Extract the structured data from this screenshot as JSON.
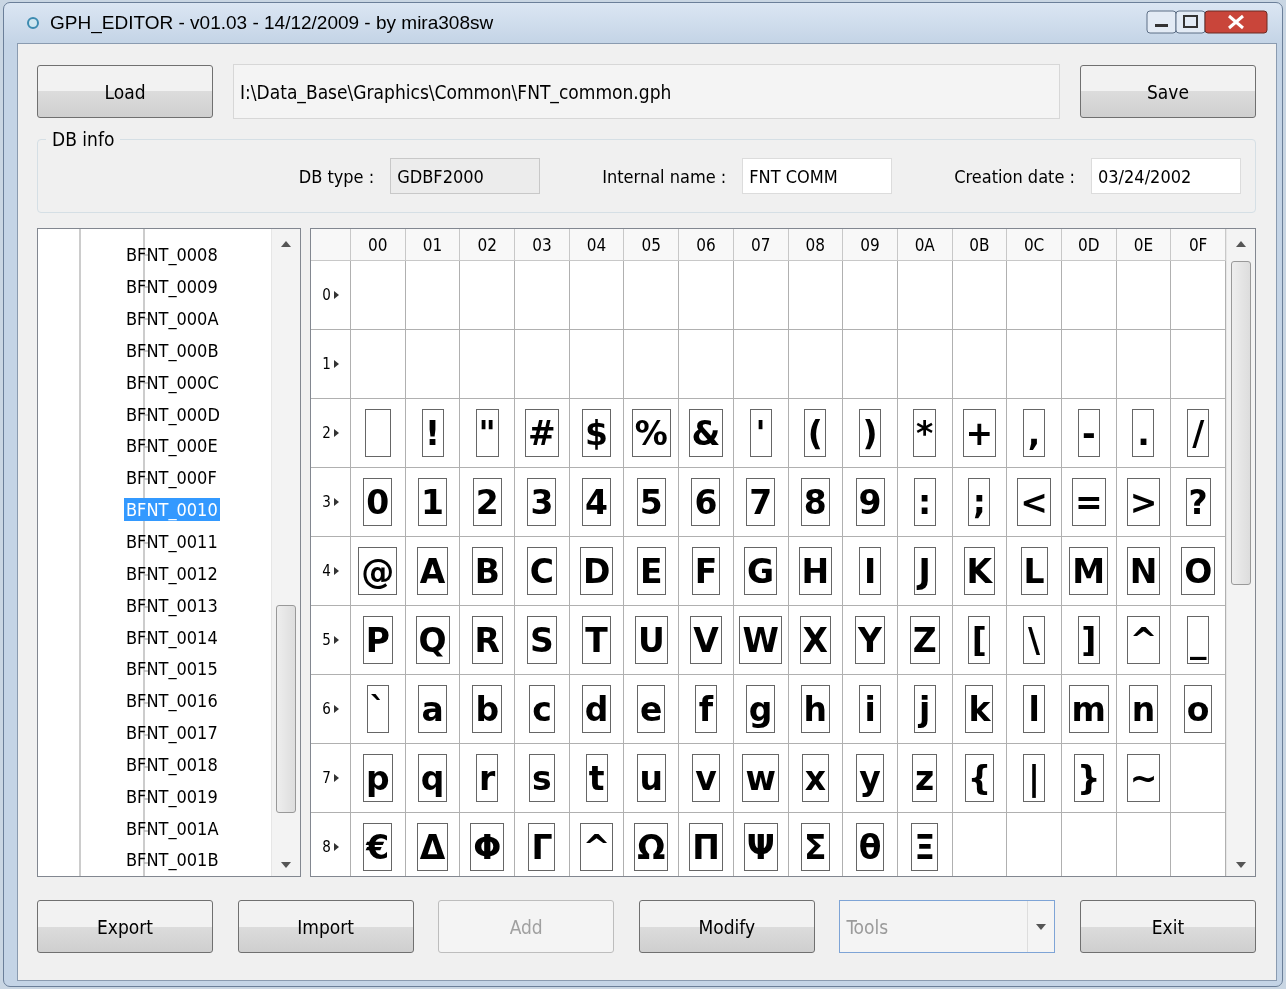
{
  "window": {
    "title": "GPH_EDITOR - v01.03 - 14/12/2009 - by mira308sw"
  },
  "top": {
    "load": "Load",
    "path": "I:\\Data_Base\\Graphics\\Common\\FNT_common.gph",
    "save": "Save"
  },
  "db_info": {
    "title": "DB info",
    "fields": [
      {
        "label": "DB type :",
        "value": "GDBF2000",
        "disabled": true
      },
      {
        "label": "Internal name :",
        "value": "FNT COMM",
        "disabled": false
      },
      {
        "label": "Creation date :",
        "value": "03/24/2002",
        "disabled": false
      }
    ]
  },
  "tree": {
    "items": [
      {
        "label": "BFNT_0008",
        "selected": false
      },
      {
        "label": "BFNT_0009",
        "selected": false
      },
      {
        "label": "BFNT_000A",
        "selected": false
      },
      {
        "label": "BFNT_000B",
        "selected": false
      },
      {
        "label": "BFNT_000C",
        "selected": false
      },
      {
        "label": "BFNT_000D",
        "selected": false
      },
      {
        "label": "BFNT_000E",
        "selected": false
      },
      {
        "label": "BFNT_000F",
        "selected": false
      },
      {
        "label": "BFNT_0010",
        "selected": true
      },
      {
        "label": "BFNT_0011",
        "selected": false
      },
      {
        "label": "BFNT_0012",
        "selected": false
      },
      {
        "label": "BFNT_0013",
        "selected": false
      },
      {
        "label": "BFNT_0014",
        "selected": false
      },
      {
        "label": "BFNT_0015",
        "selected": false
      },
      {
        "label": "BFNT_0016",
        "selected": false
      },
      {
        "label": "BFNT_0017",
        "selected": false
      },
      {
        "label": "BFNT_0018",
        "selected": false
      },
      {
        "label": "BFNT_0019",
        "selected": false
      },
      {
        "label": "BFNT_001A",
        "selected": false
      },
      {
        "label": "BFNT_001B",
        "selected": false
      }
    ]
  },
  "grid": {
    "columns": [
      "00",
      "01",
      "02",
      "03",
      "04",
      "05",
      "06",
      "07",
      "08",
      "09",
      "0A",
      "0B",
      "0C",
      "0D",
      "0E",
      "0F"
    ],
    "rows": [
      {
        "label": "0"
      },
      {
        "label": "1"
      },
      {
        "label": "2",
        "cells": [
          {
            "kind": "blank"
          },
          {
            "kind": "glyph",
            "char": "!"
          },
          {
            "kind": "glyph",
            "char": "\""
          },
          {
            "kind": "glyph",
            "char": "#"
          },
          {
            "kind": "glyph",
            "char": "$"
          },
          {
            "kind": "glyph",
            "char": "%"
          },
          {
            "kind": "glyph",
            "char": "&"
          },
          {
            "kind": "glyph",
            "char": "'"
          },
          {
            "kind": "glyph",
            "char": "("
          },
          {
            "kind": "glyph",
            "char": ")"
          },
          {
            "kind": "glyph",
            "char": "*"
          },
          {
            "kind": "glyph",
            "char": "+"
          },
          {
            "kind": "glyph",
            "char": ","
          },
          {
            "kind": "glyph",
            "char": "-"
          },
          {
            "kind": "glyph",
            "char": "."
          },
          {
            "kind": "glyph",
            "char": "/"
          }
        ]
      },
      {
        "label": "3",
        "cells": [
          {
            "kind": "glyph",
            "char": "0"
          },
          {
            "kind": "glyph",
            "char": "1"
          },
          {
            "kind": "glyph",
            "char": "2"
          },
          {
            "kind": "glyph",
            "char": "3"
          },
          {
            "kind": "glyph",
            "char": "4"
          },
          {
            "kind": "glyph",
            "char": "5"
          },
          {
            "kind": "glyph",
            "char": "6"
          },
          {
            "kind": "glyph",
            "char": "7"
          },
          {
            "kind": "glyph",
            "char": "8"
          },
          {
            "kind": "glyph",
            "char": "9"
          },
          {
            "kind": "glyph",
            "char": ":"
          },
          {
            "kind": "glyph",
            "char": ";"
          },
          {
            "kind": "glyph",
            "char": "<"
          },
          {
            "kind": "glyph",
            "char": "="
          },
          {
            "kind": "glyph",
            "char": ">"
          },
          {
            "kind": "glyph",
            "char": "?"
          }
        ]
      },
      {
        "label": "4",
        "cells": [
          {
            "kind": "glyph",
            "char": "@"
          },
          {
            "kind": "glyph",
            "char": "A"
          },
          {
            "kind": "glyph",
            "char": "B"
          },
          {
            "kind": "glyph",
            "char": "C"
          },
          {
            "kind": "glyph",
            "char": "D"
          },
          {
            "kind": "glyph",
            "char": "E"
          },
          {
            "kind": "glyph",
            "char": "F"
          },
          {
            "kind": "glyph",
            "char": "G"
          },
          {
            "kind": "glyph",
            "char": "H"
          },
          {
            "kind": "glyph",
            "char": "I"
          },
          {
            "kind": "glyph",
            "char": "J"
          },
          {
            "kind": "glyph",
            "char": "K"
          },
          {
            "kind": "glyph",
            "char": "L"
          },
          {
            "kind": "glyph",
            "char": "M"
          },
          {
            "kind": "glyph",
            "char": "N"
          },
          {
            "kind": "glyph",
            "char": "O"
          }
        ]
      },
      {
        "label": "5",
        "cells": [
          {
            "kind": "glyph",
            "char": "P"
          },
          {
            "kind": "glyph",
            "char": "Q"
          },
          {
            "kind": "glyph",
            "char": "R"
          },
          {
            "kind": "glyph",
            "char": "S"
          },
          {
            "kind": "glyph",
            "char": "T"
          },
          {
            "kind": "glyph",
            "char": "U"
          },
          {
            "kind": "glyph",
            "char": "V"
          },
          {
            "kind": "glyph",
            "char": "W"
          },
          {
            "kind": "glyph",
            "char": "X"
          },
          {
            "kind": "glyph",
            "char": "Y"
          },
          {
            "kind": "glyph",
            "char": "Z"
          },
          {
            "kind": "glyph",
            "char": "["
          },
          {
            "kind": "glyph",
            "char": "\\"
          },
          {
            "kind": "glyph",
            "char": "]"
          },
          {
            "kind": "glyph",
            "char": "^"
          },
          {
            "kind": "glyph",
            "char": "_"
          }
        ]
      },
      {
        "label": "6",
        "cells": [
          {
            "kind": "glyph",
            "char": "`"
          },
          {
            "kind": "glyph",
            "char": "a"
          },
          {
            "kind": "glyph",
            "char": "b"
          },
          {
            "kind": "glyph",
            "char": "c"
          },
          {
            "kind": "glyph",
            "char": "d"
          },
          {
            "kind": "glyph",
            "char": "e"
          },
          {
            "kind": "glyph",
            "char": "f"
          },
          {
            "kind": "glyph",
            "char": "g"
          },
          {
            "kind": "glyph",
            "char": "h"
          },
          {
            "kind": "glyph",
            "char": "i"
          },
          {
            "kind": "glyph",
            "char": "j"
          },
          {
            "kind": "glyph",
            "char": "k"
          },
          {
            "kind": "glyph",
            "char": "l"
          },
          {
            "kind": "glyph",
            "char": "m"
          },
          {
            "kind": "glyph",
            "char": "n"
          },
          {
            "kind": "glyph",
            "char": "o"
          }
        ]
      },
      {
        "label": "7",
        "cells": [
          {
            "kind": "glyph",
            "char": "p"
          },
          {
            "kind": "glyph",
            "char": "q"
          },
          {
            "kind": "glyph",
            "char": "r"
          },
          {
            "kind": "glyph",
            "char": "s"
          },
          {
            "kind": "glyph",
            "char": "t"
          },
          {
            "kind": "glyph",
            "char": "u"
          },
          {
            "kind": "glyph",
            "char": "v"
          },
          {
            "kind": "glyph",
            "char": "w"
          },
          {
            "kind": "glyph",
            "char": "x"
          },
          {
            "kind": "glyph",
            "char": "y"
          },
          {
            "kind": "glyph",
            "char": "z"
          },
          {
            "kind": "glyph",
            "char": "{"
          },
          {
            "kind": "glyph",
            "char": "|"
          },
          {
            "kind": "glyph",
            "char": "}"
          },
          {
            "kind": "glyph",
            "char": "~"
          }
        ]
      },
      {
        "label": "8",
        "cells": [
          {
            "kind": "glyph",
            "char": "€"
          },
          {
            "kind": "glyph",
            "char": "Δ"
          },
          {
            "kind": "glyph",
            "char": "Φ"
          },
          {
            "kind": "glyph",
            "char": "Γ"
          },
          {
            "kind": "glyph",
            "char": "^"
          },
          {
            "kind": "glyph",
            "char": "Ω"
          },
          {
            "kind": "glyph",
            "char": "Π"
          },
          {
            "kind": "glyph",
            "char": "Ψ"
          },
          {
            "kind": "glyph",
            "char": "Σ"
          },
          {
            "kind": "glyph",
            "char": "θ"
          },
          {
            "kind": "glyph",
            "char": "Ξ"
          }
        ]
      }
    ]
  },
  "buttons": [
    {
      "kind": "button",
      "label": "Export",
      "disabled": false
    },
    {
      "kind": "button",
      "label": "Import",
      "disabled": false
    },
    {
      "kind": "button",
      "label": "Add",
      "disabled": true
    },
    {
      "kind": "button",
      "label": "Modify",
      "disabled": false
    },
    {
      "kind": "combo",
      "label": "Tools",
      "disabled": true
    },
    {
      "kind": "button",
      "label": "Exit",
      "disabled": false
    }
  ]
}
